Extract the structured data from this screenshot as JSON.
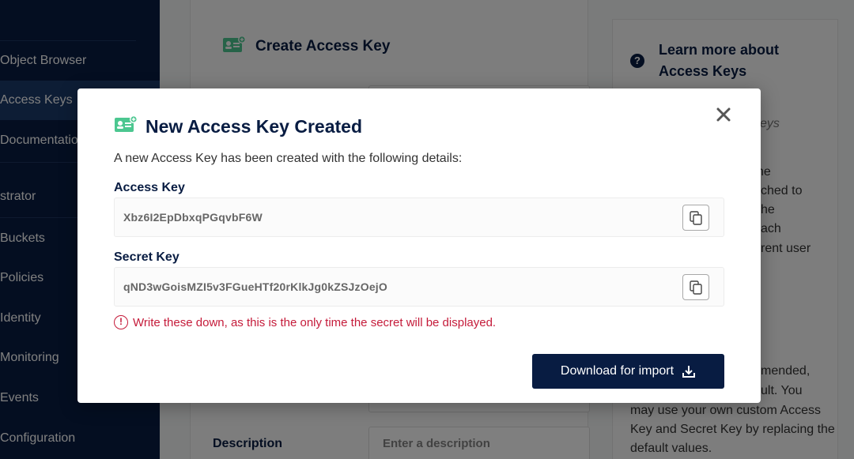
{
  "sidebar": {
    "items": [
      {
        "label": "Object Browser",
        "active": false
      },
      {
        "label": "Access Keys",
        "active": true
      },
      {
        "label": "Documentation",
        "active": false
      }
    ],
    "section_label": "strator",
    "admin_items": [
      {
        "label": "Buckets"
      },
      {
        "label": "Policies"
      },
      {
        "label": "Identity"
      },
      {
        "label": "Monitoring"
      },
      {
        "label": "Events"
      },
      {
        "label": "Configuration"
      }
    ]
  },
  "page": {
    "title": "Create Access Key",
    "description_label": "Description",
    "description_placeholder": "Enter a description"
  },
  "help": {
    "title": "Learn more about Access Keys",
    "fragments": [
      "eys",
      "he",
      "ched to",
      "he",
      "ach",
      "rent user",
      "mended,",
      "ult. You"
    ],
    "body": "may use your own custom Access Key and Secret Key by replacing the default values."
  },
  "modal": {
    "title": "New Access Key Created",
    "intro": "A new Access Key has been created with the following details:",
    "access_key_label": "Access Key",
    "access_key_value": "Xbz6I2EpDbxqPGqvbF6W",
    "secret_key_label": "Secret Key",
    "secret_key_value": "qND3wGoisMZI5v3FGueHTf20rKlkJg0kZSJzOejO",
    "warning": "Write these down, as this is the only time the secret will be displayed.",
    "download_label": "Download for import"
  },
  "colors": {
    "navy": "#081c42",
    "accent_green": "#4cc790",
    "warning_red": "#c51b3a"
  }
}
